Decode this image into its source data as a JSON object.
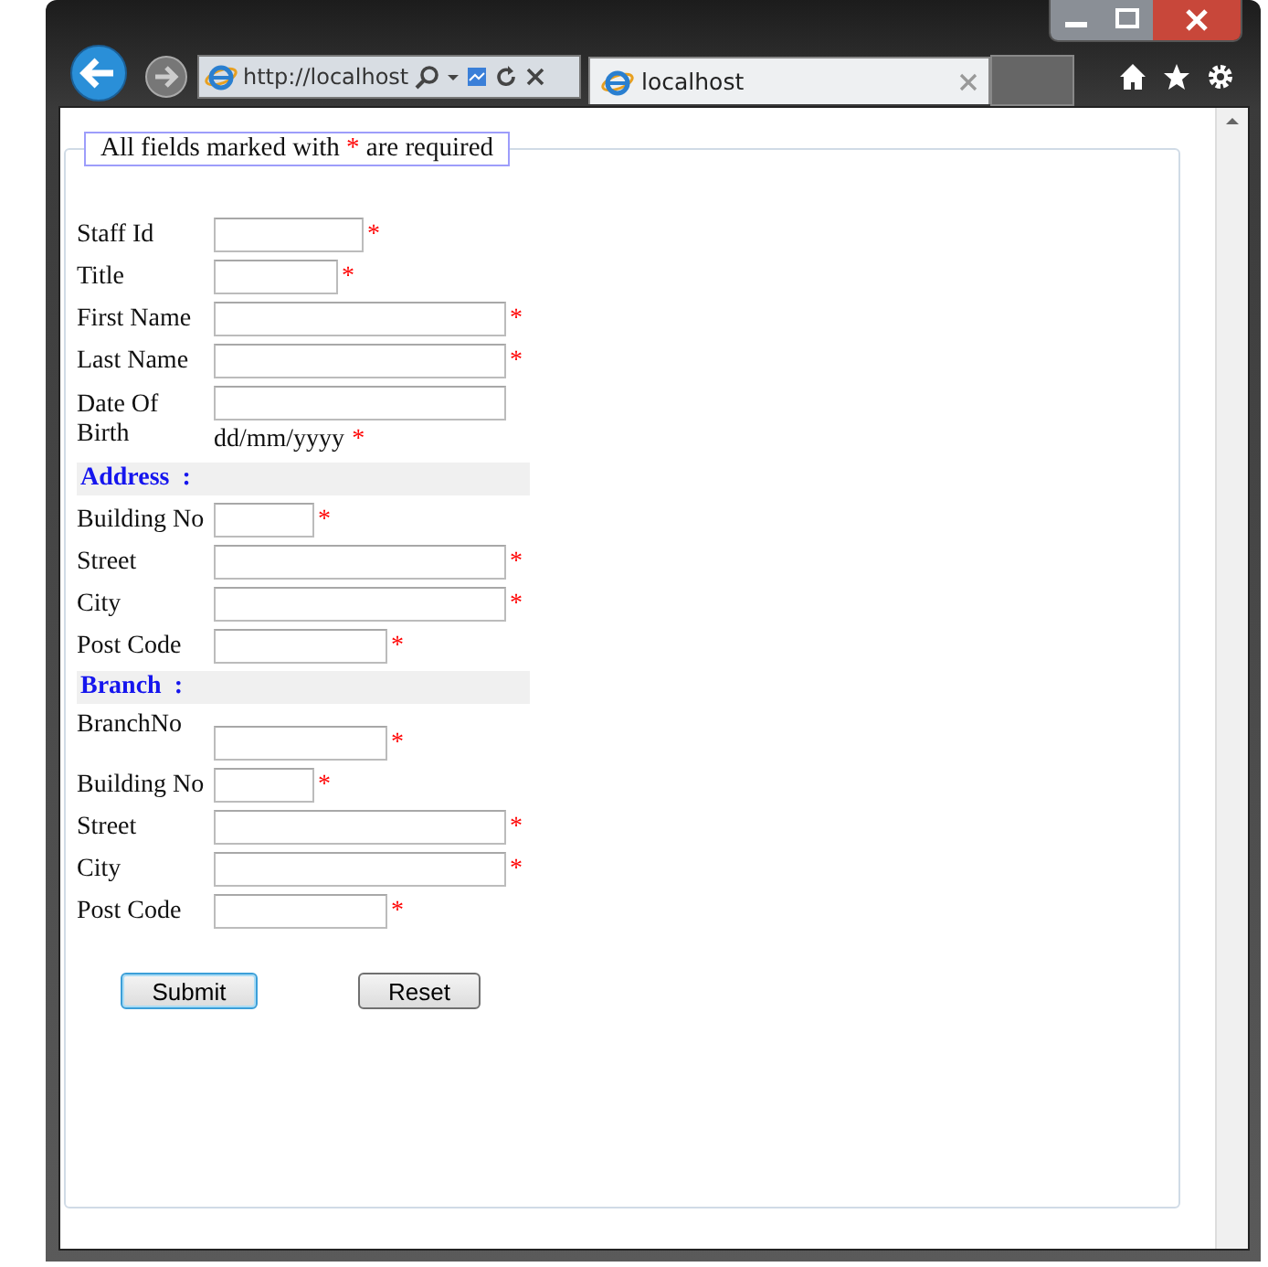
{
  "browser": {
    "address": "http://localhost",
    "tab_title": "localhost"
  },
  "form": {
    "legend": {
      "before": "All fields marked with",
      "mark": "*",
      "after": "are required"
    },
    "rows": [
      {
        "kind": "field",
        "label": "Staff Id",
        "mark": "*"
      },
      {
        "kind": "field",
        "label": "Title",
        "mark": "*"
      },
      {
        "kind": "field",
        "label": "First Name",
        "mark": "*"
      },
      {
        "kind": "field",
        "label": "Last Name",
        "mark": "*"
      },
      {
        "kind": "field",
        "label": "Date Of Birth",
        "hint": "dd/mm/yyyy",
        "mark": "*"
      },
      {
        "kind": "header",
        "label": "Address  :"
      },
      {
        "kind": "field",
        "label": "Building No",
        "mark": "*"
      },
      {
        "kind": "field",
        "label": "Street",
        "mark": "*"
      },
      {
        "kind": "field",
        "label": "City",
        "mark": "*"
      },
      {
        "kind": "field",
        "label": "Post Code",
        "mark": "*"
      },
      {
        "kind": "header",
        "label": "Branch  :"
      },
      {
        "kind": "field",
        "label": "BranchNo",
        "mark": "*"
      },
      {
        "kind": "field",
        "label": "Building No",
        "mark": "*"
      },
      {
        "kind": "field",
        "label": "Street",
        "mark": "*"
      },
      {
        "kind": "field",
        "label": "City",
        "mark": "*"
      },
      {
        "kind": "field",
        "label": "Post Code",
        "mark": "*"
      }
    ],
    "buttons": [
      {
        "label": "Submit",
        "default": true
      },
      {
        "label": "Reset",
        "default": false
      }
    ]
  }
}
